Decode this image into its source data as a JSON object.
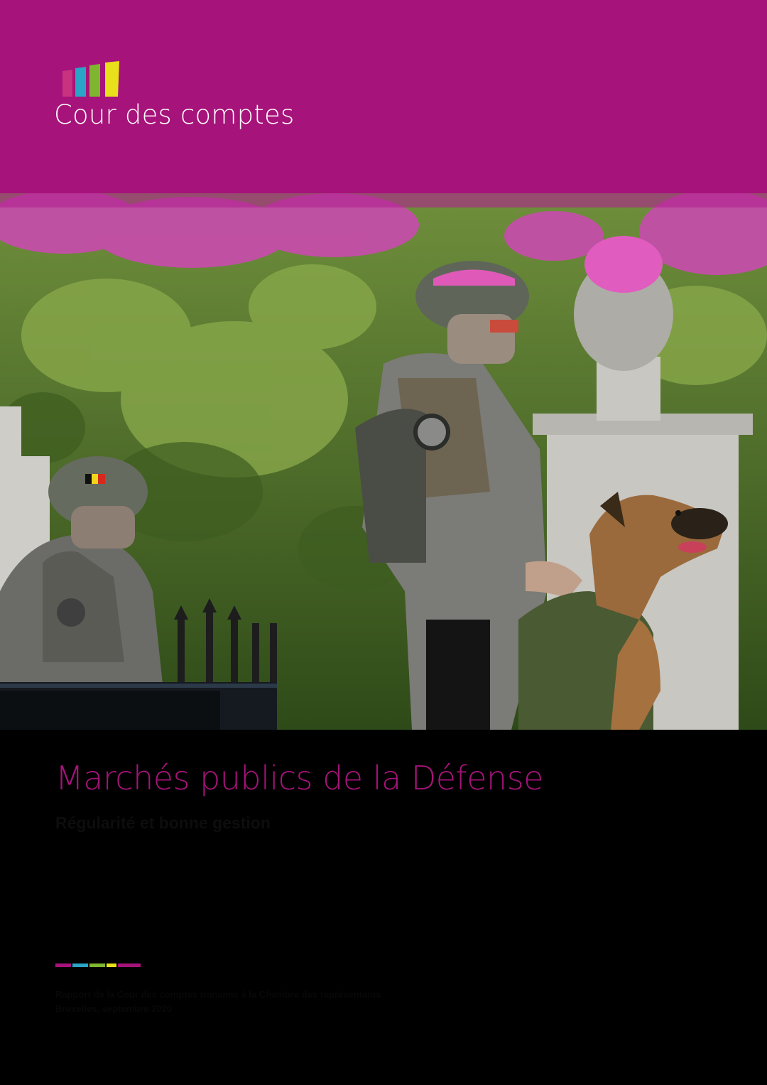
{
  "header": {
    "brand_name": "Cour des comptes",
    "background_color": "#a6137a",
    "logo_bar_colors": [
      "#c8327f",
      "#2aa5c7",
      "#7fb630",
      "#e8e01a"
    ]
  },
  "cover_photo": {
    "icon_names": [
      "soldier-icon",
      "dog-icon",
      "helmet-icon"
    ]
  },
  "document": {
    "title": "Marchés publics de la Défense",
    "subtitle": "Régularité et bonne gestion"
  },
  "footer": {
    "line1": "Rapport de la Cour des comptes transmis à la Chambre des représentants",
    "line2": "Bruxelles, septembre 2020",
    "strip_colors": [
      "#a6137a",
      "#2aa5c7",
      "#7fb630",
      "#e8e01a",
      "#a6137a"
    ]
  }
}
